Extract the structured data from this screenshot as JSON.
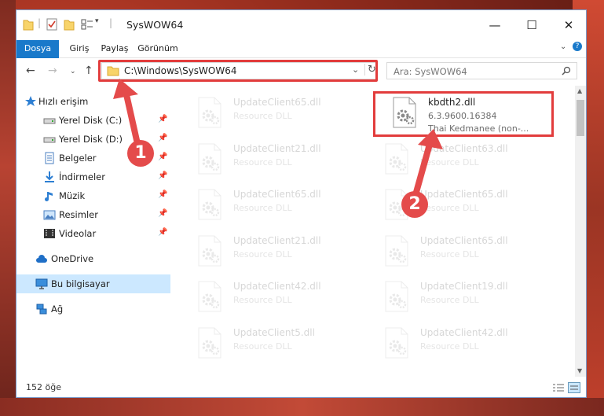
{
  "window": {
    "title": "SysWOW64",
    "minimize": "—",
    "maximize": "☐",
    "close": "✕"
  },
  "ribbon": {
    "tabs": [
      "Dosya",
      "Giriş",
      "Paylaş",
      "Görünüm"
    ]
  },
  "address": {
    "path": "C:\\Windows\\SysWOW64"
  },
  "search": {
    "placeholder": "Ara: SysWOW64"
  },
  "sidebar": {
    "items": [
      {
        "label": "Hızlı erişim",
        "icon": "star-icon"
      },
      {
        "label": "Yerel Disk (C:)",
        "icon": "drive-icon",
        "pinned": true
      },
      {
        "label": "Yerel Disk (D:)",
        "icon": "drive-icon",
        "pinned": true
      },
      {
        "label": "Belgeler",
        "icon": "documents-icon",
        "pinned": true
      },
      {
        "label": "İndirmeler",
        "icon": "download-icon",
        "pinned": true
      },
      {
        "label": "Müzik",
        "icon": "music-icon",
        "pinned": true
      },
      {
        "label": "Resimler",
        "icon": "pictures-icon",
        "pinned": true
      },
      {
        "label": "Videolar",
        "icon": "videos-icon",
        "pinned": true
      },
      {
        "label": "OneDrive",
        "icon": "cloud-icon"
      },
      {
        "label": "Bu bilgisayar",
        "icon": "computer-icon",
        "selected": true
      },
      {
        "label": "Ağ",
        "icon": "network-icon"
      }
    ]
  },
  "files": [
    {
      "name": "UpdateClient65.dll",
      "sub": "Resource DLL",
      "faded": true
    },
    {
      "name": "kbdth2.dll",
      "sub": "6.3.9600.16384",
      "sub2": "Thai Kedmanee (non-...",
      "faded": false
    },
    {
      "name": "UpdateClient21.dll",
      "sub": "Resource DLL",
      "faded": true
    },
    {
      "name": "UpdateClient63.dll",
      "sub": "Resource DLL",
      "faded": true
    },
    {
      "name": "UpdateClient65.dll",
      "sub": "Resource DLL",
      "faded": true
    },
    {
      "name": "UpdateClient65.dll",
      "sub": "Resource DLL",
      "faded": true
    },
    {
      "name": "UpdateClient21.dll",
      "sub": "Resource DLL",
      "faded": true
    },
    {
      "name": "UpdateClient65.dll",
      "sub": "Resource DLL",
      "faded": true
    },
    {
      "name": "UpdateClient42.dll",
      "sub": "Resource DLL",
      "faded": true
    },
    {
      "name": "UpdateClient19.dll",
      "sub": "Resource DLL",
      "faded": true
    },
    {
      "name": "UpdateClient5.dll",
      "sub": "Resource DLL",
      "faded": true
    },
    {
      "name": "UpdateClient42.dll",
      "sub": "Resource DLL",
      "faded": true
    }
  ],
  "status": {
    "count": "152 öğe"
  },
  "annotations": {
    "badge1": "1",
    "badge2": "2",
    "accent": "#e23c3c"
  }
}
